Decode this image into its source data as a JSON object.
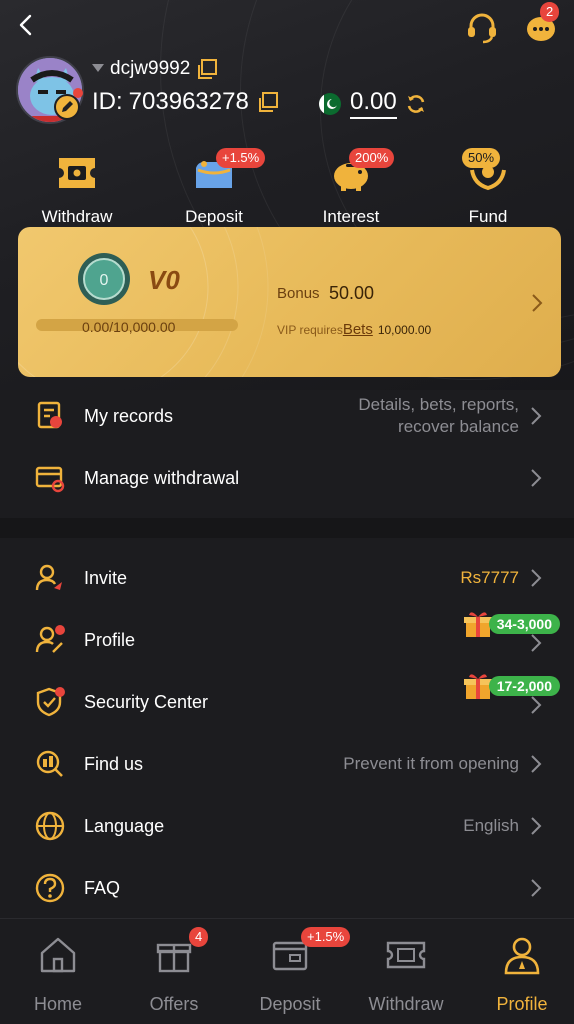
{
  "header": {
    "chat_badge": "2"
  },
  "user": {
    "username": "dcjw9992",
    "id_label": "ID:",
    "id": "703963278",
    "balance": "0.00"
  },
  "quick_actions": [
    {
      "label": "Withdraw",
      "badge": ""
    },
    {
      "label": "Deposit",
      "badge": "+1.5%"
    },
    {
      "label": "Interest",
      "badge": "200%"
    },
    {
      "label": "Fund",
      "badge": "50%"
    }
  ],
  "vip": {
    "level": "V0",
    "progress_text": "0.00/10,000.00",
    "progress_fraction": 0,
    "bonus_label": "Bonus",
    "bonus_value": "50.00",
    "requires_label": "VIP requires",
    "requires_link": "Bets",
    "requires_value": "10,000.00"
  },
  "menu1": [
    {
      "label": "My records",
      "value_line1": "Details, bets, reports,",
      "value_line2": "recover balance"
    },
    {
      "label": "Manage withdrawal",
      "value": ""
    }
  ],
  "menu2": [
    {
      "label": "Invite",
      "value": "Rs7777"
    },
    {
      "label": "Profile",
      "gift": "34-3,000"
    },
    {
      "label": "Security Center",
      "gift": "17-2,000"
    },
    {
      "label": "Find us",
      "value": "Prevent it from opening"
    },
    {
      "label": "Language",
      "value": "English"
    },
    {
      "label": "FAQ",
      "value": ""
    }
  ],
  "nav": [
    {
      "label": "Home",
      "badge": ""
    },
    {
      "label": "Offers",
      "badge": "4"
    },
    {
      "label": "Deposit",
      "badge": "+1.5%"
    },
    {
      "label": "Withdraw",
      "badge": ""
    },
    {
      "label": "Profile",
      "badge": ""
    }
  ],
  "colors": {
    "accent": "#f0b33c",
    "badge": "#e8453c",
    "gift_tag": "#3db34a",
    "vip_card": "#e8bb5b"
  }
}
